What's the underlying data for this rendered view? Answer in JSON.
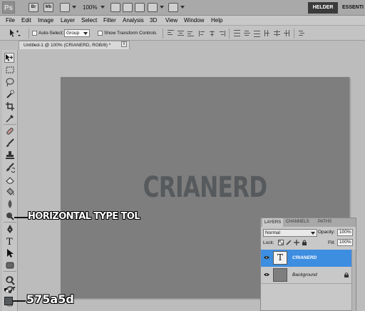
{
  "app": {
    "logo": "Ps",
    "bridge_icon": "Br",
    "minibridge_icon": "Mb",
    "zoom": "100%",
    "workspace_active": "HELDER",
    "workspace_next": "ESSENTI"
  },
  "menu": [
    "File",
    "Edit",
    "Image",
    "Layer",
    "Select",
    "Filter",
    "Analysis",
    "3D",
    "View",
    "Window",
    "Help"
  ],
  "options": {
    "auto_select_label": "Auto-Select:",
    "auto_select_value": "Group",
    "show_transform_label": "Show Transform Controls"
  },
  "document": {
    "tab_title": "Untitled-1 @ 100% (CRIANERD, RGB/8) *",
    "close_glyph": "x",
    "canvas_text": "CRIANERD",
    "canvas_bg": "#7e7e7e",
    "text_color": "#575a5d"
  },
  "tools": {
    "icons": [
      "move-tool",
      "marquee-tool",
      "lasso-tool",
      "quick-selection-tool",
      "crop-tool",
      "eyedropper-tool",
      "spot-healing-tool",
      "brush-tool",
      "clone-stamp-tool",
      "history-brush-tool",
      "eraser-tool",
      "gradient-tool",
      "blur-tool",
      "dodge-tool",
      "pen-tool",
      "type-tool",
      "path-selection-tool",
      "shape-tool",
      "3d-rotate-tool",
      "3d-camera-tool",
      "hand-tool",
      "zoom-tool"
    ],
    "foreground_color": "#575a5d"
  },
  "callouts": {
    "type_tool": "HORIZONTAL TYPE TOL",
    "color_code": "575a5d"
  },
  "layers_panel": {
    "tabs": [
      "LAYERS",
      "CHANNELS",
      "PATHS"
    ],
    "blend_mode": "Normal",
    "opacity_label": "Opacity:",
    "opacity_value": "100%",
    "lock_label": "Lock:",
    "fill_label": "Fill:",
    "fill_value": "100%",
    "layers": [
      {
        "name": "CRIANERD",
        "type": "text",
        "thumb_glyph": "T",
        "selected": true
      },
      {
        "name": "Background",
        "type": "image",
        "locked": true,
        "selected": false
      }
    ],
    "selected_color": "#3d8de0"
  }
}
